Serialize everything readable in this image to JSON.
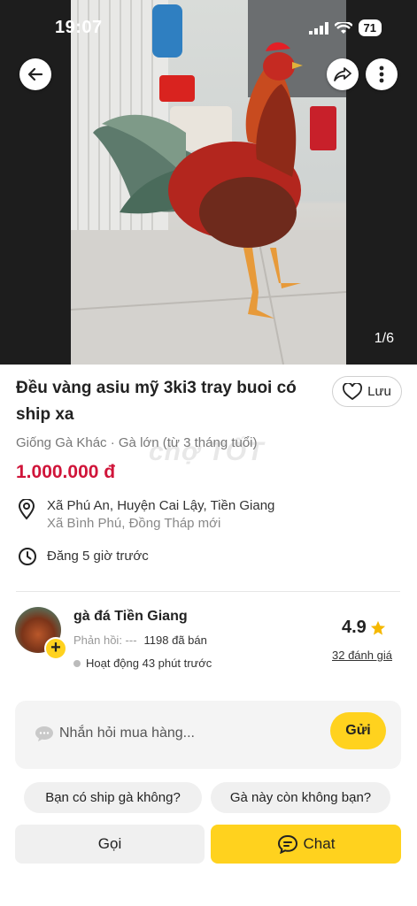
{
  "status_bar": {
    "time": "19:07",
    "battery": "71"
  },
  "hero": {
    "image_counter": "1/6",
    "icons": {
      "back": "arrow-left-icon",
      "share": "share-icon",
      "more": "more-vertical-icon"
    }
  },
  "listing": {
    "title": "Đều vàng asiu mỹ 3ki3 tray buoi có ship xa",
    "save_label": "Lưu",
    "category": "Giống Gà Khác · Gà lớn (từ 3 tháng tuổi)",
    "watermark": "chợ TỐT",
    "price": "1.000.000 đ",
    "location_primary": "Xã Phú An, Huyện Cai Lậy, Tiền Giang",
    "location_secondary": "Xã Bình Phú, Đồng Tháp mới",
    "posted": "Đăng 5 giờ trước"
  },
  "seller": {
    "name": "gà đá Tiền Giang",
    "response_label": "Phản hồi: ---",
    "sold": "1198 đã bán",
    "active": "Hoạt động 43 phút trước",
    "rating": "4.9",
    "reviews": "32 đánh giá"
  },
  "chat": {
    "placeholder": "Nhắn hỏi mua hàng...",
    "send_label": "Gửi",
    "quick_replies": [
      "Bạn có ship gà không?",
      "Gà này còn không bạn?"
    ]
  },
  "actions": {
    "call_label": "Gọi",
    "chat_label": "Chat"
  },
  "colors": {
    "accent": "#ffd21e",
    "price": "#d0153a",
    "star": "#f5b800"
  }
}
